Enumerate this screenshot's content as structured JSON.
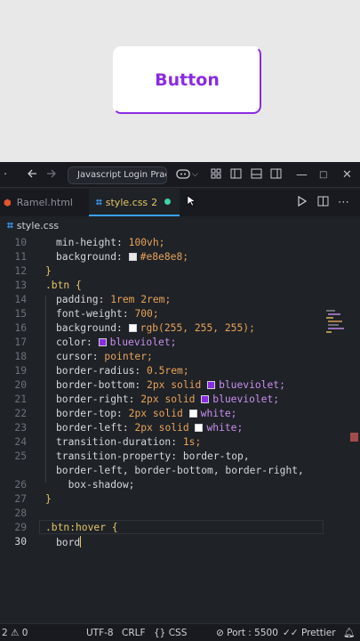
{
  "preview": {
    "button_label": "Button"
  },
  "titlebar": {
    "back_icon": "arrow-left",
    "forward_icon": "arrow-right",
    "search_text": "Javascript Login Practice",
    "copilot_icon": "copilot",
    "layout_icons": [
      "layout-customize",
      "toggle-primary-sidebar",
      "toggle-panel",
      "toggle-secondary-sidebar"
    ],
    "window_controls": [
      "minimize",
      "maximize",
      "close"
    ]
  },
  "tabs": [
    {
      "label": "Ramel.html",
      "icon": "html-file-icon",
      "active": false
    },
    {
      "label": "style.css",
      "icon": "css-file-icon",
      "active": true,
      "problems": "2",
      "modified": true
    }
  ],
  "breadcrumb": {
    "file": "style.css"
  },
  "code_lines": {
    "l10": {
      "num": "10",
      "prop": "min-height:",
      "value": "100vh;"
    },
    "l11": {
      "num": "11",
      "prop": "background:",
      "value": "#e8e8e8;",
      "swatch": "#e8e8e8"
    },
    "l12": {
      "num": "12",
      "text": "}"
    },
    "l13": {
      "num": "13",
      "text": ".btn {"
    },
    "l14": {
      "num": "14",
      "prop": "padding:",
      "value": "1rem 2rem;"
    },
    "l15": {
      "num": "15",
      "prop": "font-weight:",
      "value": "700;"
    },
    "l16": {
      "num": "16",
      "prop": "background:",
      "value": "rgb(255, 255, 255);",
      "swatch": "#ffffff"
    },
    "l17": {
      "num": "17",
      "prop": "color:",
      "value": "blueviolet;",
      "swatch": "#8a2be2"
    },
    "l18": {
      "num": "18",
      "prop": "cursor:",
      "value": "pointer;"
    },
    "l19": {
      "num": "19",
      "prop": "border-radius:",
      "value": "0.5rem;"
    },
    "l20": {
      "num": "20",
      "prop": "border-bottom:",
      "value": "2px solid",
      "color": "blueviolet;",
      "swatch": "#8a2be2"
    },
    "l21": {
      "num": "21",
      "prop": "border-right:",
      "value": "2px solid",
      "color": "blueviolet;",
      "swatch": "#8a2be2"
    },
    "l22": {
      "num": "22",
      "prop": "border-top:",
      "value": "2px solid",
      "color": "white;",
      "swatch": "#ffffff"
    },
    "l23": {
      "num": "23",
      "prop": "border-left:",
      "value": "2px solid",
      "color": "white;",
      "swatch": "#ffffff"
    },
    "l24": {
      "num": "24",
      "prop": "transition-duration:",
      "value": "1s;"
    },
    "l25": {
      "num": "25",
      "prop": "transition-property:",
      "value": "border-top,",
      "wrap": "border-left, border-bottom, border-right,"
    },
    "l26": {
      "num": "26",
      "text": "  box-shadow;"
    },
    "l27": {
      "num": "27",
      "text": "}"
    },
    "l28": {
      "num": "28",
      "text": ""
    },
    "l29": {
      "num": "29",
      "text": ".btn:hover {"
    },
    "l30": {
      "num": "30",
      "text": "bord"
    }
  },
  "statusbar": {
    "problems": "2",
    "warnings": "0",
    "encoding": "UTF-8",
    "eol": "CRLF",
    "language": "CSS",
    "port": "Port : 5500",
    "prettier": "Prettier"
  },
  "colors": {
    "accent": "#8a2be2",
    "editor_bg": "#1f2227",
    "tab_active_border": "#3aa1ff",
    "modified_dot": "#3ed3a6"
  }
}
